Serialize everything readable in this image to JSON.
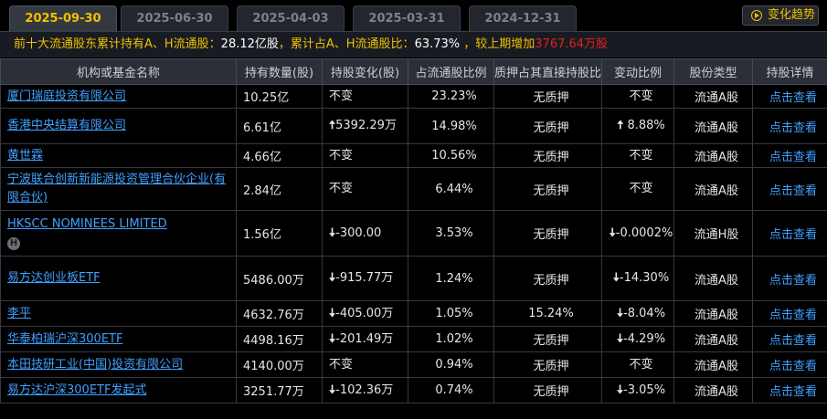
{
  "tabs": [
    {
      "label": "2025-09-30",
      "active": true
    },
    {
      "label": "2025-06-30",
      "active": false
    },
    {
      "label": "2025-04-03",
      "active": false
    },
    {
      "label": "2025-03-31",
      "active": false
    },
    {
      "label": "2024-12-31",
      "active": false
    }
  ],
  "trend_button": {
    "label": "变化趋势",
    "icon": "play-circle-icon"
  },
  "summary": {
    "prefix": "前十大流通股东累计持有A、H流通股：",
    "total": "28.12亿股",
    "mid": "，累计占A、H流通股比：",
    "ratio": "63.73%",
    "suffix": " ，较上期增加",
    "increase": "3767.64万股"
  },
  "columns": [
    "机构或基金名称",
    "持有数量(股)",
    "持股变化(股)",
    "占流通股比例",
    "质押占其直接持股比",
    "变动比例",
    "股份类型",
    "持股详情"
  ],
  "rows": [
    {
      "name": "厦门瑞庭投资有限公司",
      "qty": "10.25亿",
      "change": "不变",
      "change_dir": "",
      "ratio": "23.23%",
      "pledge": "无质押",
      "pct": "不变",
      "pct_dir": "",
      "type": "流通A股",
      "detail": "点击查看",
      "badge": ""
    },
    {
      "name": "香港中央结算有限公司",
      "qty": "6.61亿",
      "change": "5392.29万",
      "change_dir": "up",
      "ratio": "14.98%",
      "pledge": "无质押",
      "pct": "8.88%",
      "pct_dir": "up",
      "type": "流通A股",
      "detail": "点击查看",
      "badge": ""
    },
    {
      "name": "黄世霖",
      "qty": "4.66亿",
      "change": "不变",
      "change_dir": "",
      "ratio": "10.56%",
      "pledge": "无质押",
      "pct": "不变",
      "pct_dir": "",
      "type": "流通A股",
      "detail": "点击查看",
      "badge": ""
    },
    {
      "name": "宁波联合创新新能源投资管理合伙企业(有限合伙)",
      "qty": "2.84亿",
      "change": "不变",
      "change_dir": "",
      "ratio": "6.44%",
      "pledge": "无质押",
      "pct": "不变",
      "pct_dir": "",
      "type": "流通A股",
      "detail": "点击查看",
      "badge": ""
    },
    {
      "name": "HKSCC NOMINEES LIMITED",
      "qty": "1.56亿",
      "change": "-300.00",
      "change_dir": "down",
      "ratio": "3.53%",
      "pledge": "无质押",
      "pct": "-0.0002%",
      "pct_dir": "down",
      "type": "流通H股",
      "detail": "点击查看",
      "badge": "H"
    },
    {
      "name": "易方达创业板ETF",
      "qty": "5486.00万",
      "change": "-915.77万",
      "change_dir": "down",
      "ratio": "1.24%",
      "pledge": "无质押",
      "pct": "-14.30%",
      "pct_dir": "down",
      "type": "流通A股",
      "detail": "点击查看",
      "badge": ""
    },
    {
      "name": "李平",
      "qty": "4632.76万",
      "change": "-405.00万",
      "change_dir": "down",
      "ratio": "1.05%",
      "pledge": "15.24%",
      "pct": "-8.04%",
      "pct_dir": "down",
      "type": "流通A股",
      "detail": "点击查看",
      "badge": ""
    },
    {
      "name": "华泰柏瑞沪深300ETF",
      "qty": "4498.16万",
      "change": "-201.49万",
      "change_dir": "down",
      "ratio": "1.02%",
      "pledge": "无质押",
      "pct": "-4.29%",
      "pct_dir": "down",
      "type": "流通A股",
      "detail": "点击查看",
      "badge": ""
    },
    {
      "name": "本田技研工业(中国)投资有限公司",
      "qty": "4140.00万",
      "change": "不变",
      "change_dir": "",
      "ratio": "0.94%",
      "pledge": "无质押",
      "pct": "不变",
      "pct_dir": "",
      "type": "流通A股",
      "detail": "点击查看",
      "badge": ""
    },
    {
      "name": "易方达沪深300ETF发起式",
      "qty": "3251.77万",
      "change": "-102.36万",
      "change_dir": "down",
      "ratio": "0.74%",
      "pledge": "无质押",
      "pct": "-3.05%",
      "pct_dir": "down",
      "type": "流通A股",
      "detail": "点击查看",
      "badge": ""
    }
  ],
  "colors": {
    "accent": "#f0c000",
    "up": "#e61e1e",
    "down": "#2cbf2c",
    "link": "#3fa0ff"
  }
}
